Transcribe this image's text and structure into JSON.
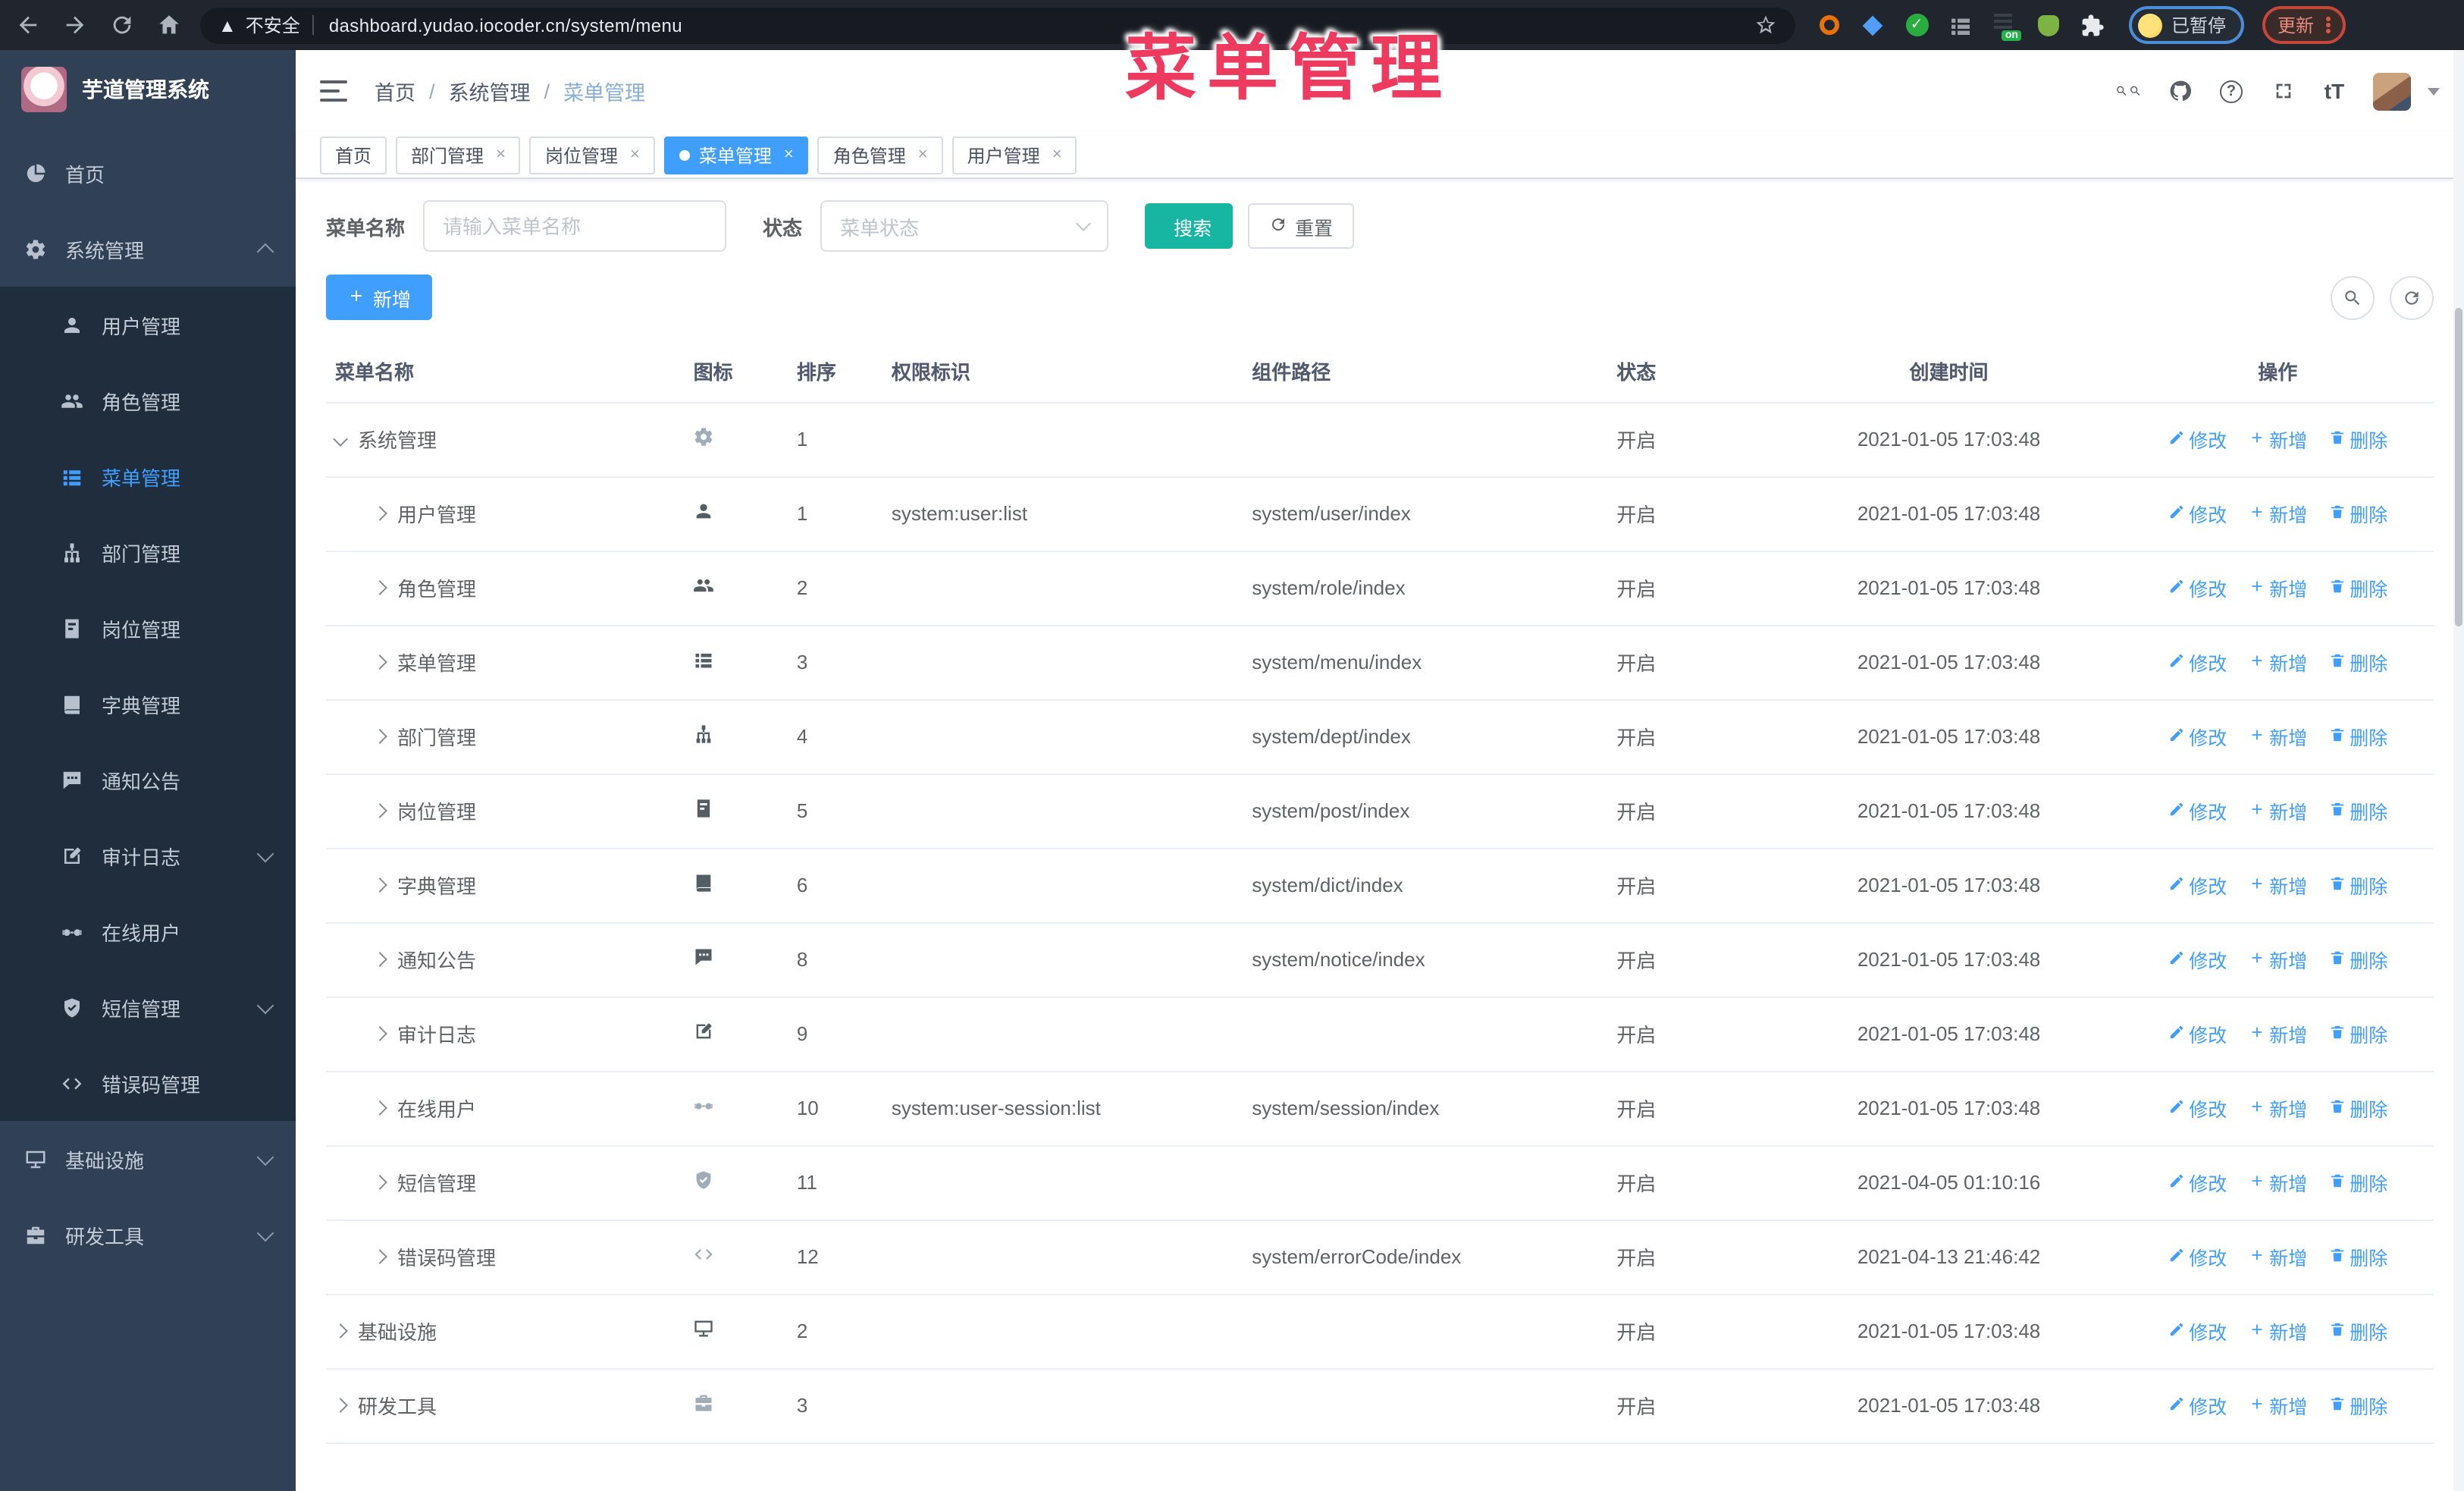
{
  "browser": {
    "security_label": "不安全",
    "url": "dashboard.yudao.iocoder.cn/system/menu",
    "paused_label": "已暂停",
    "update_label": "更新",
    "nav_icons": [
      "back-arrow",
      "forward-arrow",
      "reload",
      "home"
    ],
    "extension_icons": [
      "bookmark-star",
      "orange-ring",
      "blue-gem",
      "green-check",
      "tab-group",
      "on-badge",
      "green-droid",
      "puzzle"
    ]
  },
  "annotation": {
    "text": "菜单管理",
    "color": "#ee3a5f"
  },
  "sidebar": {
    "logo_title": "芋道管理系统",
    "items": [
      {
        "label": "首页",
        "icon": "dashboard",
        "level": 0,
        "active": false,
        "arrow": ""
      },
      {
        "label": "系统管理",
        "icon": "gear",
        "level": 0,
        "active": false,
        "arrow": "up"
      },
      {
        "label": "用户管理",
        "icon": "user",
        "level": 1,
        "active": false,
        "arrow": ""
      },
      {
        "label": "角色管理",
        "icon": "users",
        "level": 1,
        "active": false,
        "arrow": ""
      },
      {
        "label": "菜单管理",
        "icon": "menu",
        "level": 1,
        "active": true,
        "arrow": ""
      },
      {
        "label": "部门管理",
        "icon": "tree",
        "level": 1,
        "active": false,
        "arrow": ""
      },
      {
        "label": "岗位管理",
        "icon": "badge",
        "level": 1,
        "active": false,
        "arrow": ""
      },
      {
        "label": "字典管理",
        "icon": "book",
        "level": 1,
        "active": false,
        "arrow": ""
      },
      {
        "label": "通知公告",
        "icon": "message",
        "level": 1,
        "active": false,
        "arrow": ""
      },
      {
        "label": "审计日志",
        "icon": "log",
        "level": 1,
        "active": false,
        "arrow": "down"
      },
      {
        "label": "在线用户",
        "icon": "online",
        "level": 1,
        "active": false,
        "arrow": ""
      },
      {
        "label": "短信管理",
        "icon": "shield",
        "level": 1,
        "active": false,
        "arrow": "down"
      },
      {
        "label": "错误码管理",
        "icon": "code",
        "level": 1,
        "active": false,
        "arrow": ""
      },
      {
        "label": "基础设施",
        "icon": "monitor",
        "level": 0,
        "active": false,
        "arrow": "down"
      },
      {
        "label": "研发工具",
        "icon": "toolbox",
        "level": 0,
        "active": false,
        "arrow": "down"
      }
    ]
  },
  "navbar": {
    "breadcrumb": [
      "首页",
      "系统管理",
      "菜单管理"
    ],
    "font_size_label": "tT",
    "question_mark": "?",
    "icons": [
      "search",
      "github",
      "question",
      "fullscreen",
      "font-size",
      "avatar",
      "caret-down"
    ]
  },
  "tabs": [
    {
      "label": "首页",
      "closable": false,
      "active": false
    },
    {
      "label": "部门管理",
      "closable": true,
      "active": false
    },
    {
      "label": "岗位管理",
      "closable": true,
      "active": false
    },
    {
      "label": "菜单管理",
      "closable": true,
      "active": true
    },
    {
      "label": "角色管理",
      "closable": true,
      "active": false
    },
    {
      "label": "用户管理",
      "closable": true,
      "active": false
    }
  ],
  "filters": {
    "name_label": "菜单名称",
    "name_placeholder": "请输入菜单名称",
    "status_label": "状态",
    "status_placeholder": "菜单状态",
    "search_label": "搜索",
    "reset_label": "重置"
  },
  "toolbar": {
    "add_label": "新增"
  },
  "table": {
    "columns": [
      "菜单名称",
      "图标",
      "排序",
      "权限标识",
      "组件路径",
      "状态",
      "创建时间",
      "操作"
    ],
    "row_actions": {
      "edit": "修改",
      "add": "新增",
      "delete": "删除"
    },
    "rows": [
      {
        "name": "系统管理",
        "icon": "gear",
        "muted": true,
        "level": 0,
        "expanded": true,
        "sort": "1",
        "perm": "",
        "path": "",
        "status": "开启",
        "time": "2021-01-05 17:03:48"
      },
      {
        "name": "用户管理",
        "icon": "user",
        "muted": false,
        "level": 1,
        "expanded": false,
        "sort": "1",
        "perm": "system:user:list",
        "path": "system/user/index",
        "status": "开启",
        "time": "2021-01-05 17:03:48"
      },
      {
        "name": "角色管理",
        "icon": "users",
        "muted": false,
        "level": 1,
        "expanded": false,
        "sort": "2",
        "perm": "",
        "path": "system/role/index",
        "status": "开启",
        "time": "2021-01-05 17:03:48"
      },
      {
        "name": "菜单管理",
        "icon": "menu",
        "muted": false,
        "level": 1,
        "expanded": false,
        "sort": "3",
        "perm": "",
        "path": "system/menu/index",
        "status": "开启",
        "time": "2021-01-05 17:03:48"
      },
      {
        "name": "部门管理",
        "icon": "tree",
        "muted": false,
        "level": 1,
        "expanded": false,
        "sort": "4",
        "perm": "",
        "path": "system/dept/index",
        "status": "开启",
        "time": "2021-01-05 17:03:48"
      },
      {
        "name": "岗位管理",
        "icon": "badge",
        "muted": false,
        "level": 1,
        "expanded": false,
        "sort": "5",
        "perm": "",
        "path": "system/post/index",
        "status": "开启",
        "time": "2021-01-05 17:03:48"
      },
      {
        "name": "字典管理",
        "icon": "book",
        "muted": false,
        "level": 1,
        "expanded": false,
        "sort": "6",
        "perm": "",
        "path": "system/dict/index",
        "status": "开启",
        "time": "2021-01-05 17:03:48"
      },
      {
        "name": "通知公告",
        "icon": "message",
        "muted": false,
        "level": 1,
        "expanded": false,
        "sort": "8",
        "perm": "",
        "path": "system/notice/index",
        "status": "开启",
        "time": "2021-01-05 17:03:48"
      },
      {
        "name": "审计日志",
        "icon": "log",
        "muted": false,
        "level": 1,
        "expanded": false,
        "sort": "9",
        "perm": "",
        "path": "",
        "status": "开启",
        "time": "2021-01-05 17:03:48"
      },
      {
        "name": "在线用户",
        "icon": "online",
        "muted": true,
        "level": 1,
        "expanded": false,
        "sort": "10",
        "perm": "system:user-session:list",
        "path": "system/session/index",
        "status": "开启",
        "time": "2021-01-05 17:03:48"
      },
      {
        "name": "短信管理",
        "icon": "shield",
        "muted": true,
        "level": 1,
        "expanded": false,
        "sort": "11",
        "perm": "",
        "path": "",
        "status": "开启",
        "time": "2021-04-05 01:10:16"
      },
      {
        "name": "错误码管理",
        "icon": "code",
        "muted": true,
        "level": 1,
        "expanded": false,
        "sort": "12",
        "perm": "",
        "path": "system/errorCode/index",
        "status": "开启",
        "time": "2021-04-13 21:46:42"
      },
      {
        "name": "基础设施",
        "icon": "monitor",
        "muted": false,
        "level": 0,
        "expanded": false,
        "sort": "2",
        "perm": "",
        "path": "",
        "status": "开启",
        "time": "2021-01-05 17:03:48"
      },
      {
        "name": "研发工具",
        "icon": "toolbox",
        "muted": true,
        "level": 0,
        "expanded": false,
        "sort": "3",
        "perm": "",
        "path": "",
        "status": "开启",
        "time": "2021-01-05 17:03:48"
      }
    ]
  },
  "colors": {
    "accent": "#409eff",
    "search_button": "#17b6a3",
    "sidebar_bg": "#304156",
    "submenu_bg": "#1f2d3d",
    "annotation": "#ee3a5f",
    "active_tab": "#409eff"
  }
}
